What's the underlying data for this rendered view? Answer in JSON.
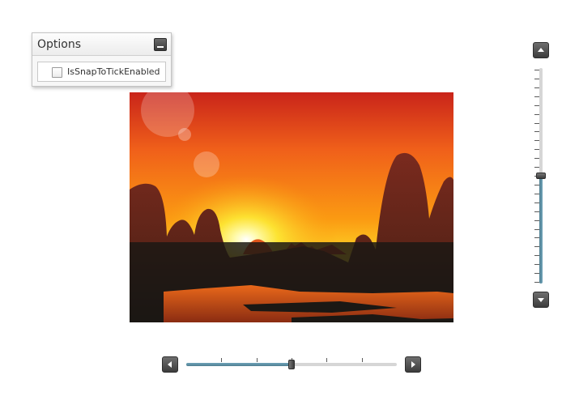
{
  "options_panel": {
    "title": "Options",
    "minimize_icon": "minimize-icon",
    "checkbox": {
      "label": "IsSnapToTickEnabled",
      "checked": false
    }
  },
  "image": {
    "description_icon": "sunset-landscape"
  },
  "vertical_slider": {
    "value_fraction": 0.5,
    "tick_count": 24,
    "accent_color": "#5b8ea3",
    "up_icon": "arrow-up-icon",
    "down_icon": "arrow-down-icon"
  },
  "horizontal_slider": {
    "value_fraction": 0.5,
    "tick_count": 5,
    "accent_color": "#5b8ea3",
    "left_icon": "arrow-left-icon",
    "right_icon": "arrow-right-icon"
  }
}
